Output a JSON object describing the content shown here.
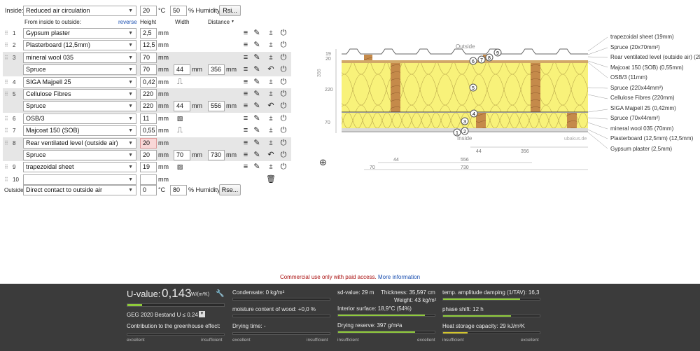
{
  "inside": {
    "label": "Inside:",
    "condition": "Reduced air circulation",
    "temp": "20",
    "temp_unit": "°C",
    "humidity": "50",
    "humidity_unit": "% Humidity",
    "rsi_button": "Rsi..."
  },
  "headers": {
    "from": "From inside to outside:",
    "reverse": "reverse",
    "height": "Height",
    "width": "Width",
    "distance": "Distance"
  },
  "units": {
    "mm": "mm"
  },
  "layers": [
    {
      "num": "1",
      "material": "Gypsum plaster",
      "height": "2,5"
    },
    {
      "num": "2",
      "material": "Plasterboard (12,5mm)",
      "height": "12,5"
    },
    {
      "num": "3",
      "material": "mineral wool 035",
      "height": "70",
      "sub": {
        "material": "Spruce",
        "height": "70",
        "width": "44",
        "distance": "356"
      }
    },
    {
      "num": "4",
      "material": "SIGA Majpell 25",
      "height": "0,42"
    },
    {
      "num": "5",
      "material": "Cellulose Fibres",
      "height": "220",
      "sub": {
        "material": "Spruce",
        "height": "220",
        "width": "44",
        "distance": "556"
      }
    },
    {
      "num": "6",
      "material": "OSB/3",
      "height": "11"
    },
    {
      "num": "7",
      "material": "Majcoat 150 (SOB)",
      "height": "0,55"
    },
    {
      "num": "8",
      "material": "Rear ventilated level (outside air)",
      "height": "20",
      "sub": {
        "material": "Spruce",
        "height": "20",
        "width": "70",
        "distance": "730"
      }
    },
    {
      "num": "9",
      "material": "trapezoidal sheet",
      "height": "19"
    },
    {
      "num": "10",
      "material": "",
      "height": ""
    }
  ],
  "outside": {
    "label": "Outside",
    "condition": "Direct contact to outside air",
    "temp": "0",
    "temp_unit": "°C",
    "humidity": "80",
    "humidity_unit": "% Humidity",
    "rse_button": "Rse..."
  },
  "diagram": {
    "outside_label": "Outside",
    "inside_label": "Inside",
    "watermark": "ubakus.de",
    "dim_left": [
      "19",
      "20",
      "220",
      "70",
      "356"
    ],
    "dim_bottom": [
      "44",
      "356",
      "44",
      "556",
      "70",
      "730"
    ],
    "legend": [
      "trapezoidal sheet (19mm)",
      "Spruce (20x70mm²)",
      "Rear ventilated level (outside air) (20",
      "Majcoat 150 (SOB) (0,55mm)",
      "OSB/3 (11mm)",
      "Spruce (220x44mm²)",
      "Cellulose Fibres (220mm)",
      "SIGA Majpell 25 (0,42mm)",
      "Spruce (70x44mm²)",
      "mineral wool 035 (70mm)",
      "Plasterboard (12,5mm) (12,5mm)",
      "Gypsum plaster (2,5mm)"
    ],
    "markers": [
      "1",
      "2",
      "3",
      "4",
      "5",
      "6",
      "7",
      "8",
      "9"
    ]
  },
  "notice": {
    "text": "Commercial use only with paid access.",
    "link": "More information"
  },
  "results": {
    "uvalue_label": "U-value:",
    "uvalue": "0,143",
    "uvalue_unit": "W/(m²K)",
    "geg": "GEG 2020 Bestand U ≤ 0.24",
    "greenhouse": "Contribution to the greenhouse effect:",
    "condensate": "Condensate: 0 kg/m²",
    "moisture": "moisture content of wood: +0,0 %",
    "drying_time": "Drying time: -",
    "sd_value": "sd-value: 29 m",
    "thickness": "Thickness: 35,597 cm",
    "weight": "Weight: 43 kg/m²",
    "interior_surface": "Interior surface: 18,9°C (54%)",
    "drying_reserve": "Drying reserve: 397 g/m²a",
    "temp_damping": "temp. amplitude damping (1/TAV): 16,3",
    "phase_shift": "phase shift: 12 h",
    "heat_storage": "Heat storage capacity: 29 kJ/m²K",
    "excellent": "excellent",
    "insufficient": "insufficient",
    "colors": {
      "good": "#8fcb3a",
      "bad": "#d03a2a"
    }
  }
}
